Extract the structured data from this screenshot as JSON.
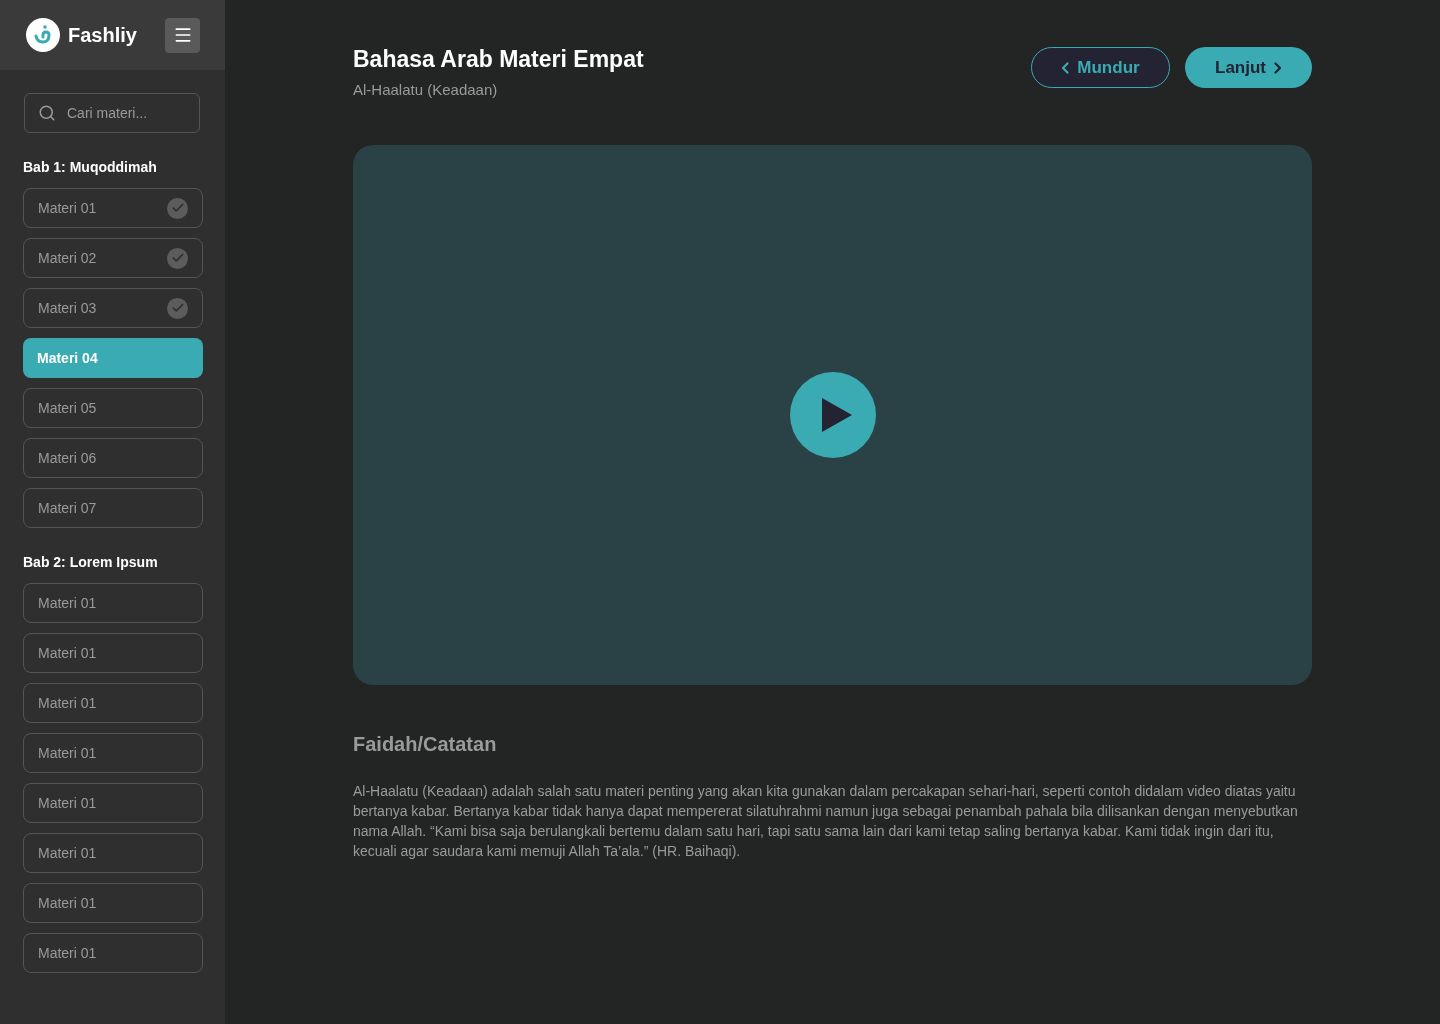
{
  "brand": {
    "name": "Fashliy"
  },
  "search": {
    "placeholder": "Cari materi..."
  },
  "chapters": [
    {
      "title": "Bab 1: Muqoddimah",
      "items": [
        {
          "label": "Materi 01",
          "completed": true,
          "selected": false
        },
        {
          "label": "Materi 02",
          "completed": true,
          "selected": false
        },
        {
          "label": "Materi 03",
          "completed": true,
          "selected": false
        },
        {
          "label": "Materi 04",
          "completed": false,
          "selected": true
        },
        {
          "label": "Materi 05",
          "completed": false,
          "selected": false
        },
        {
          "label": "Materi 06",
          "completed": false,
          "selected": false
        },
        {
          "label": "Materi 07",
          "completed": false,
          "selected": false
        }
      ]
    },
    {
      "title": "Bab 2: Lorem Ipsum",
      "items": [
        {
          "label": "Materi 01",
          "completed": false,
          "selected": false
        },
        {
          "label": "Materi 01",
          "completed": false,
          "selected": false
        },
        {
          "label": "Materi 01",
          "completed": false,
          "selected": false
        },
        {
          "label": "Materi 01",
          "completed": false,
          "selected": false
        },
        {
          "label": "Materi 01",
          "completed": false,
          "selected": false
        },
        {
          "label": "Materi 01",
          "completed": false,
          "selected": false
        },
        {
          "label": "Materi 01",
          "completed": false,
          "selected": false
        },
        {
          "label": "Materi 01",
          "completed": false,
          "selected": false
        }
      ]
    }
  ],
  "lesson": {
    "title": "Bahasa Arab Materi Empat",
    "subtitle": "Al-Haalatu (Keadaan)",
    "prev_button": "Mundur",
    "next_button": "Lanjut"
  },
  "notes": {
    "heading": "Faidah/Catatan",
    "body": "Al-Haalatu (Keadaan) adalah salah satu materi penting yang akan kita gunakan dalam percakapan sehari-hari, seperti contoh didalam video diatas yaitu bertanya kabar. Bertanya kabar tidak hanya dapat mempererat silatuhrahmi namun juga sebagai penambah pahala bila dilisankan dengan menyebutkan nama Allah. “Kami bisa saja berulangkali bertemu dalam satu hari, tapi satu sama lain dari kami tetap saling bertanya kabar. Kami tidak ingin dari itu, kecuali agar saudara kami memuji Allah Ta’ala.” (HR. Baihaqi)."
  }
}
